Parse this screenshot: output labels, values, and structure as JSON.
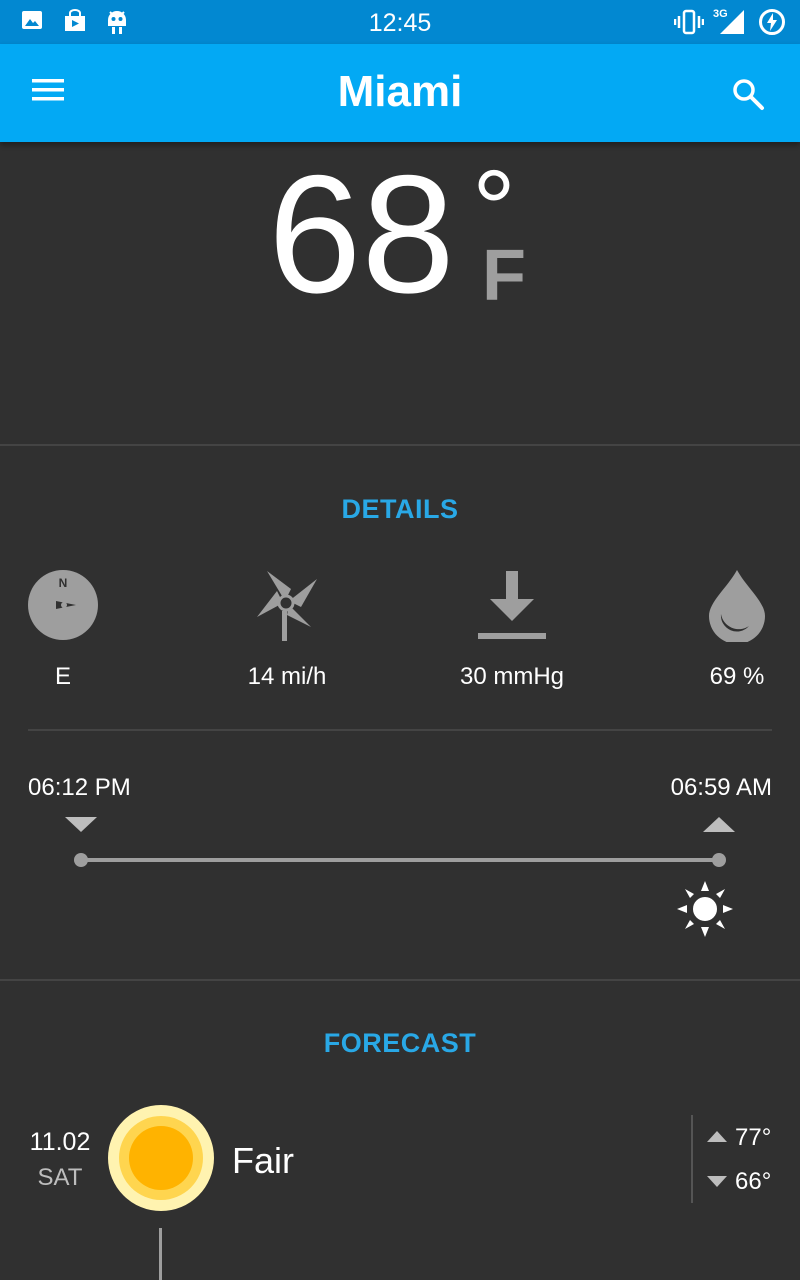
{
  "status_bar": {
    "time": "12:45",
    "network": "3G"
  },
  "app_bar": {
    "title": "Miami"
  },
  "current": {
    "temperature": "68",
    "degree_symbol": "°",
    "unit": "F"
  },
  "details": {
    "title": "DETAILS",
    "items": [
      {
        "icon": "compass-icon",
        "value": "E"
      },
      {
        "icon": "wind-icon",
        "value": "14 mi/h"
      },
      {
        "icon": "pressure-icon",
        "value": "30 mmHg"
      },
      {
        "icon": "humidity-icon",
        "value": "69 %"
      }
    ]
  },
  "sun": {
    "sunset": "06:12 PM",
    "sunrise": "06:59 AM"
  },
  "forecast": {
    "title": "FORECAST",
    "days": [
      {
        "date": "11.02",
        "day": "SAT",
        "condition": "Fair",
        "high": "77°",
        "low": "66°"
      }
    ]
  },
  "colors": {
    "accent": "#29a8e6",
    "app_bar": "#03a9f4",
    "status_bar": "#0288d1",
    "background": "#303030"
  }
}
